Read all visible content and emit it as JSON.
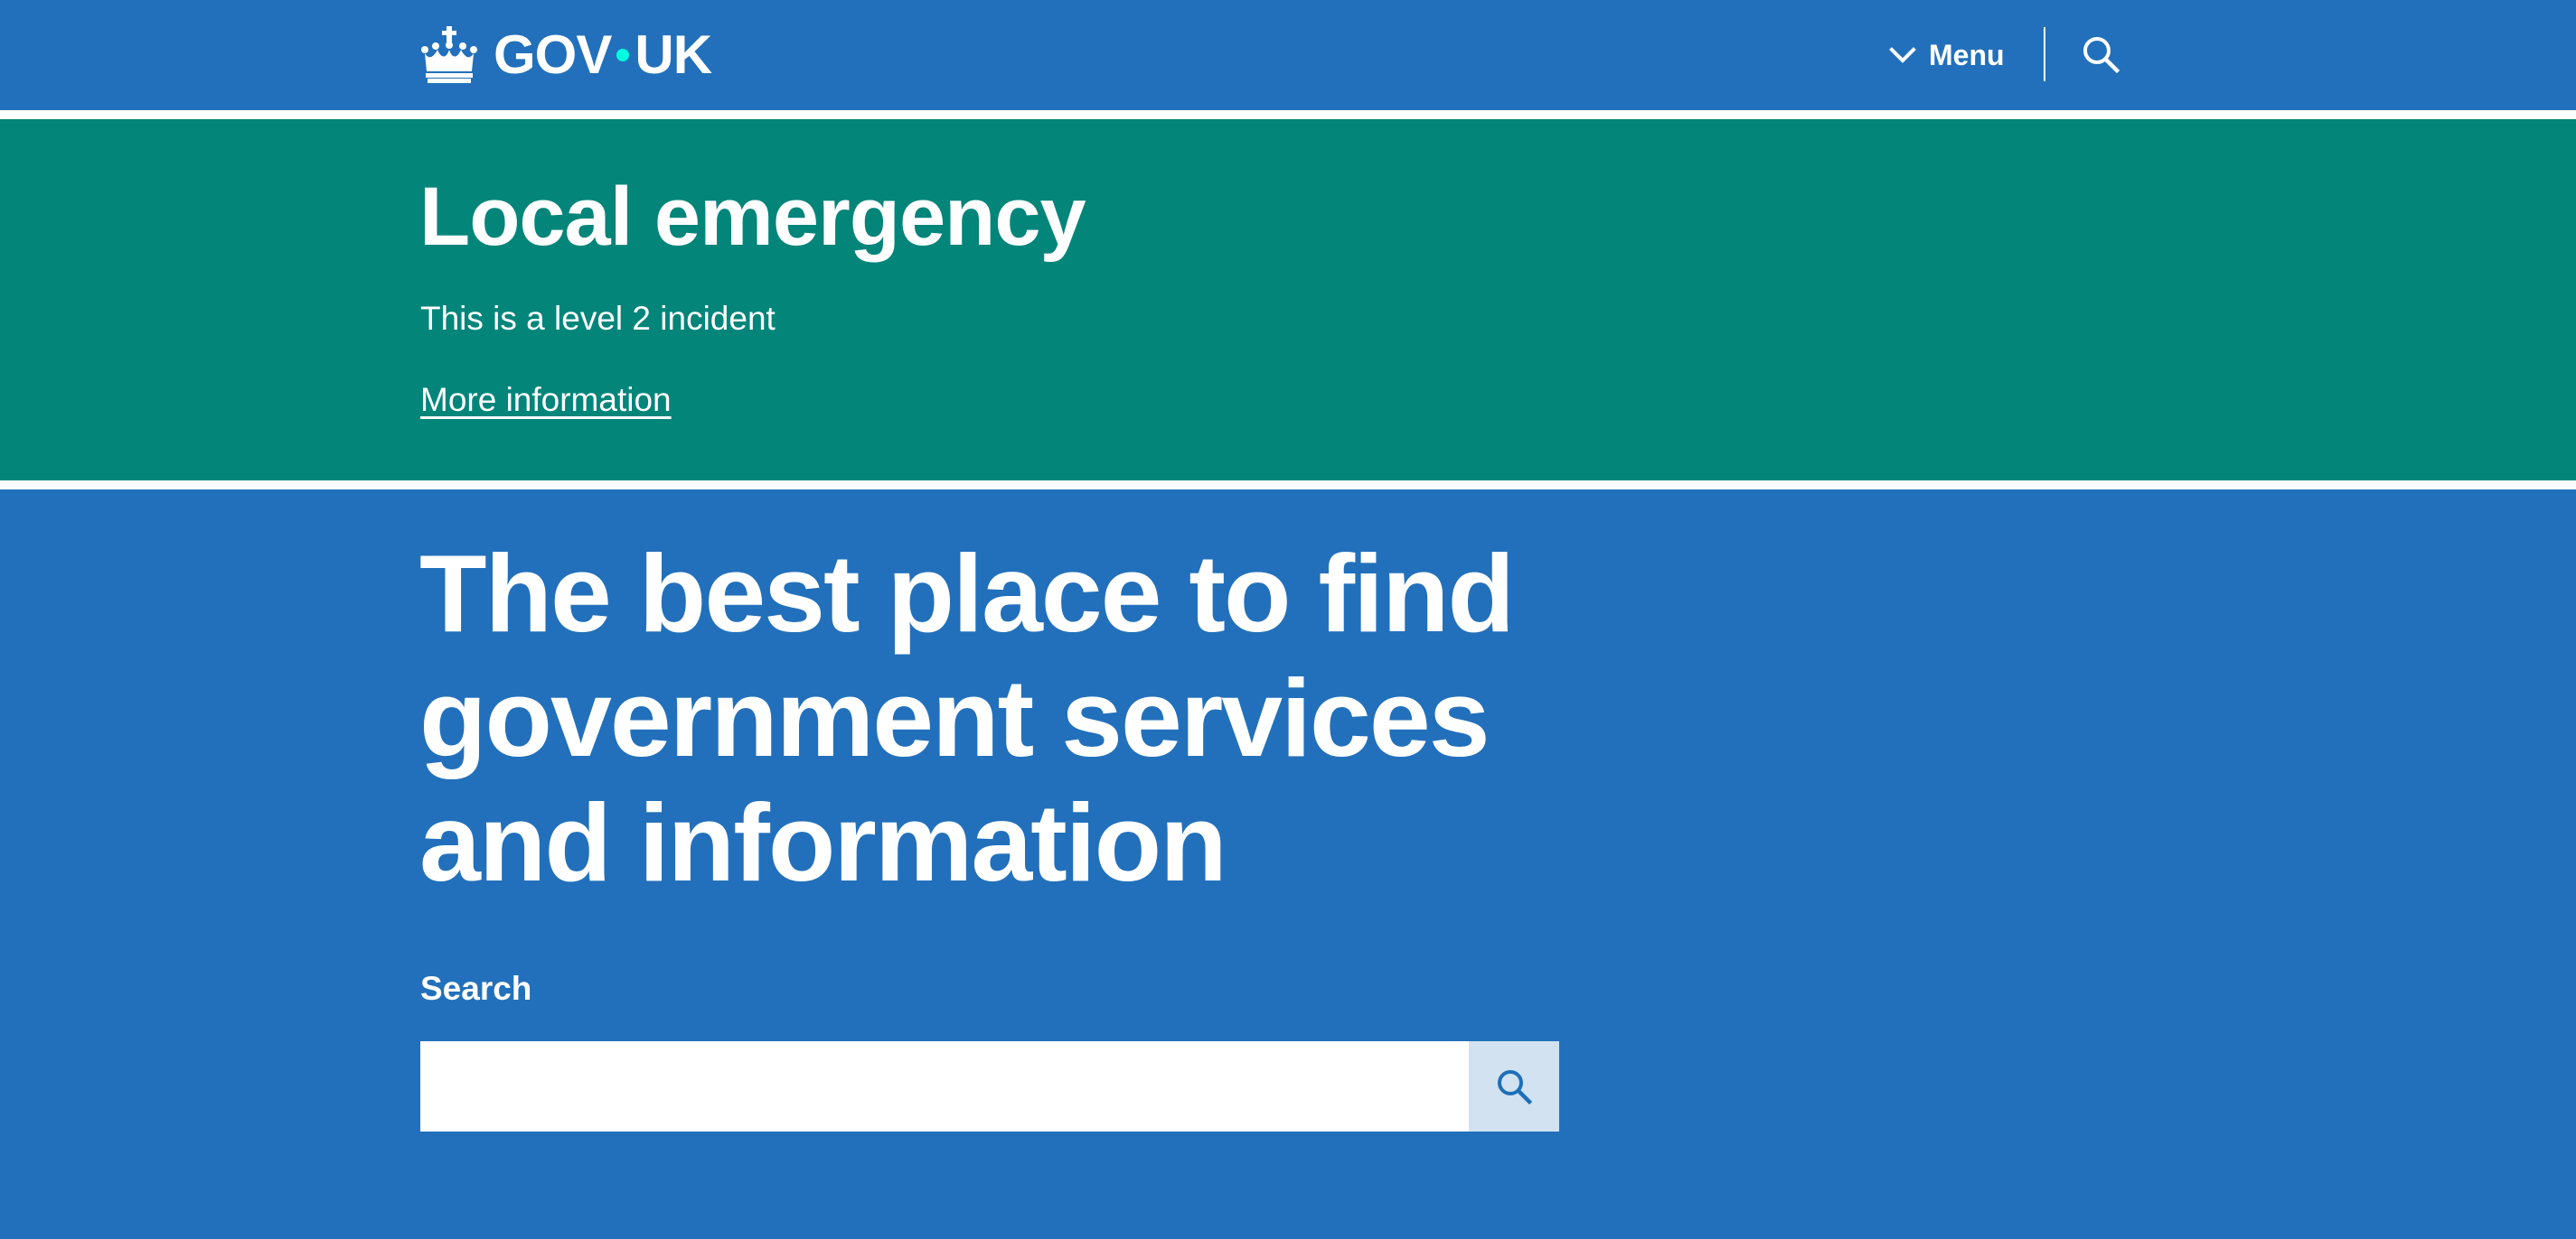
{
  "header": {
    "logo": {
      "icon": "crown-icon",
      "text_left": "GOV",
      "text_right": "UK"
    },
    "menu": {
      "icon": "chevron-down-icon",
      "label": "Menu"
    },
    "search_toggle": {
      "icon": "search-icon"
    }
  },
  "emergency_banner": {
    "title": "Local emergency",
    "text": "This is a level 2 incident",
    "link_label": "More information"
  },
  "hero": {
    "title": "The best place to find government services and information",
    "search": {
      "label": "Search",
      "value": "",
      "placeholder": "",
      "submit_icon": "search-icon"
    }
  },
  "colors": {
    "brand_blue": "#2270bb",
    "emergency_green": "#03857a",
    "logo_dot": "#00ffe0",
    "search_button_bg": "#d2e2f1",
    "search_icon": "#1d70b8"
  }
}
